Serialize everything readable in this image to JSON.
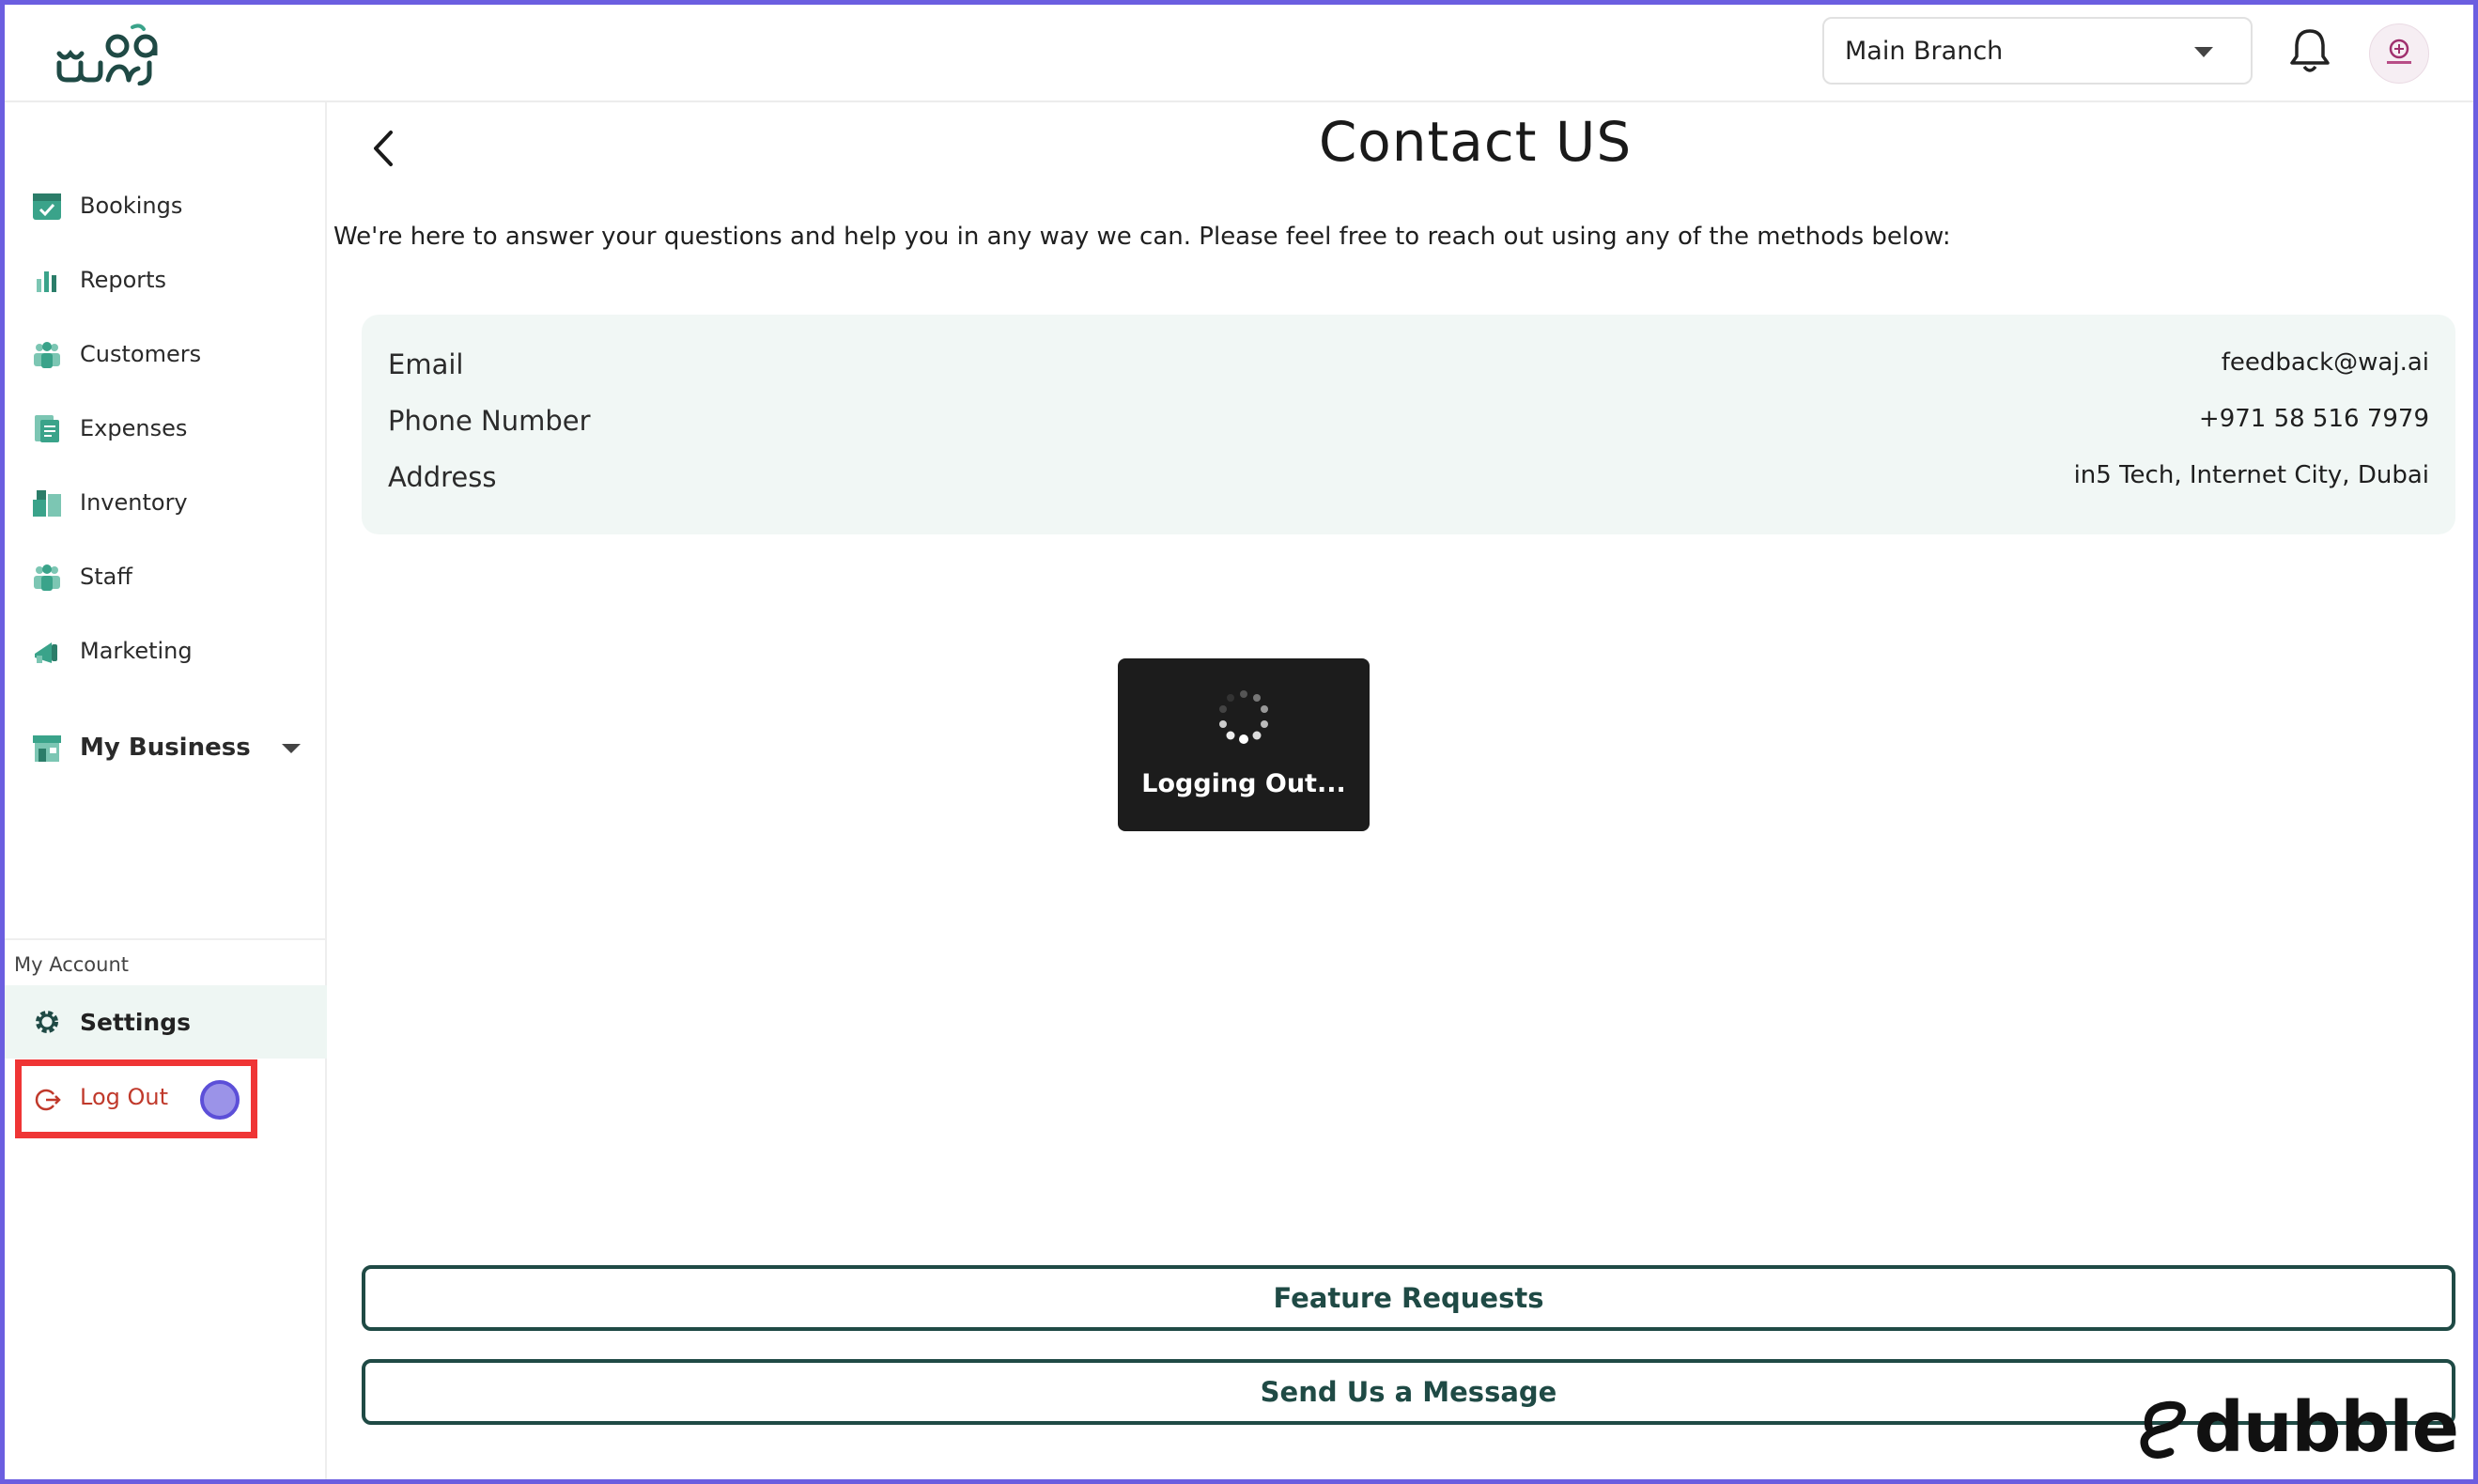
{
  "header": {
    "logo_text": "waj",
    "branch_selector": {
      "selected": "Main Branch"
    },
    "icons": {
      "bell": "bell-icon",
      "avatar": "avatar"
    }
  },
  "sidebar": {
    "items": [
      {
        "label": "Bookings",
        "icon": "calendar-check-icon"
      },
      {
        "label": "Reports",
        "icon": "bar-chart-icon"
      },
      {
        "label": "Customers",
        "icon": "people-icon"
      },
      {
        "label": "Expenses",
        "icon": "receipt-icon"
      },
      {
        "label": "Inventory",
        "icon": "boxes-icon"
      },
      {
        "label": "Staff",
        "icon": "staff-icon"
      },
      {
        "label": "Marketing",
        "icon": "megaphone-icon"
      }
    ],
    "business": {
      "label": "My Business",
      "icon": "storefront-icon"
    },
    "account_section_label": "My Account",
    "settings_label": "Settings",
    "logout_label": "Log Out"
  },
  "main": {
    "title": "Contact US",
    "intro": "We're here to answer your questions and help you in any way we can. Please feel free to reach out using any of the methods below:",
    "contact": [
      {
        "label": "Email",
        "value": "feedback@waj.ai"
      },
      {
        "label": "Phone Number",
        "value": "+971 58 516 7979"
      },
      {
        "label": "Address",
        "value": "in5 Tech, Internet City, Dubai"
      }
    ],
    "toast": "Logging Out...",
    "feature_requests_label": "Feature Requests",
    "send_message_label": "Send Us a Message"
  },
  "watermark": "dubble",
  "colors": {
    "brand_teal": "#1f4a45",
    "accent_green": "#3aa38a",
    "card_bg": "#f1f7f5",
    "logout_red": "#c0392b",
    "highlight_red": "#ef3535",
    "frame_purple": "#6b5ee0"
  }
}
